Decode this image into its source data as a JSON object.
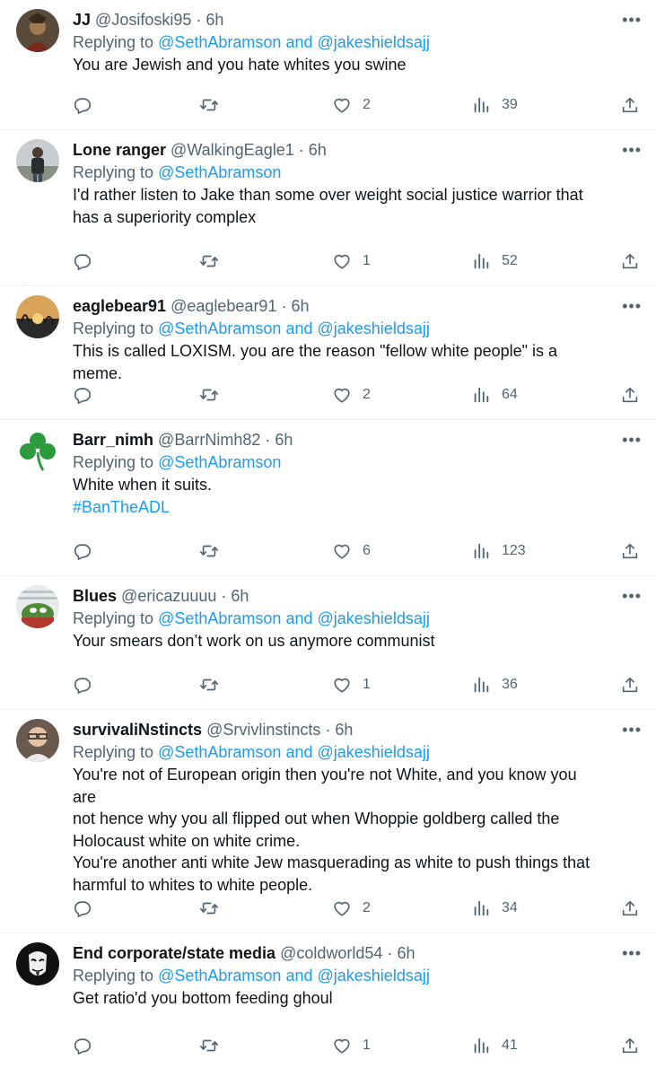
{
  "replying_to_label": "Replying to",
  "and_label": "and",
  "more_label": "•••",
  "tweets": [
    {
      "name": "JJ",
      "handle": "@Josifoski95",
      "time": "6h",
      "mentions": [
        "@SethAbramson",
        "@jakeshieldsajj"
      ],
      "body": [
        "You are Jewish and you hate whites you swine"
      ],
      "likes": "2",
      "views": "39",
      "avatar": "dark-portrait"
    },
    {
      "name": "Lone ranger",
      "handle": "@WalkingEagle1",
      "time": "6h",
      "mentions": [
        "@SethAbramson"
      ],
      "body": [
        "I'd rather listen to Jake than some over weight social justice warrior that",
        "has a superiority complex"
      ],
      "likes": "1",
      "views": "52",
      "avatar": "person-outdoors"
    },
    {
      "name": "eaglebear91",
      "handle": "@eaglebear91",
      "time": "6h",
      "mentions": [
        "@SethAbramson",
        "@jakeshieldsajj"
      ],
      "body": [
        "This is called LOXISM. you are the reason \"fellow white people\" is a meme."
      ],
      "likes": "2",
      "views": "64",
      "avatar": "sunset"
    },
    {
      "name": "Barr_nimh",
      "handle": "@BarrNimh82",
      "time": "6h",
      "mentions": [
        "@SethAbramson"
      ],
      "body": [
        "White when it suits."
      ],
      "hashtag": "#BanTheADL",
      "likes": "6",
      "views": "123",
      "avatar": "shamrock"
    },
    {
      "name": "Blues",
      "handle": "@ericazuuuu",
      "time": "6h",
      "mentions": [
        "@SethAbramson",
        "@jakeshieldsajj"
      ],
      "body": [
        "Your smears don’t work on us anymore communist"
      ],
      "likes": "1",
      "views": "36",
      "avatar": "frog-cartoon"
    },
    {
      "name": "survivaliNstincts",
      "handle": "@Srvivlinstincts",
      "time": "6h",
      "mentions": [
        "@SethAbramson",
        "@jakeshieldsajj"
      ],
      "body": [
        "You're not of European origin then you're not White, and you know you are",
        "not hence why you all flipped out when Whoppie goldberg called the",
        "Holocaust white on white crime.",
        "You're another anti white Jew masquerading as white to push things that",
        "harmful to whites to white people."
      ],
      "likes": "2",
      "views": "34",
      "avatar": "person-glasses"
    },
    {
      "name": "End corporate/state media",
      "handle": "@coldworld54",
      "time": "6h",
      "mentions": [
        "@SethAbramson",
        "@jakeshieldsajj"
      ],
      "body": [
        "Get ratio'd you bottom feeding ghoul"
      ],
      "likes": "1",
      "views": "41",
      "avatar": "mask"
    }
  ]
}
